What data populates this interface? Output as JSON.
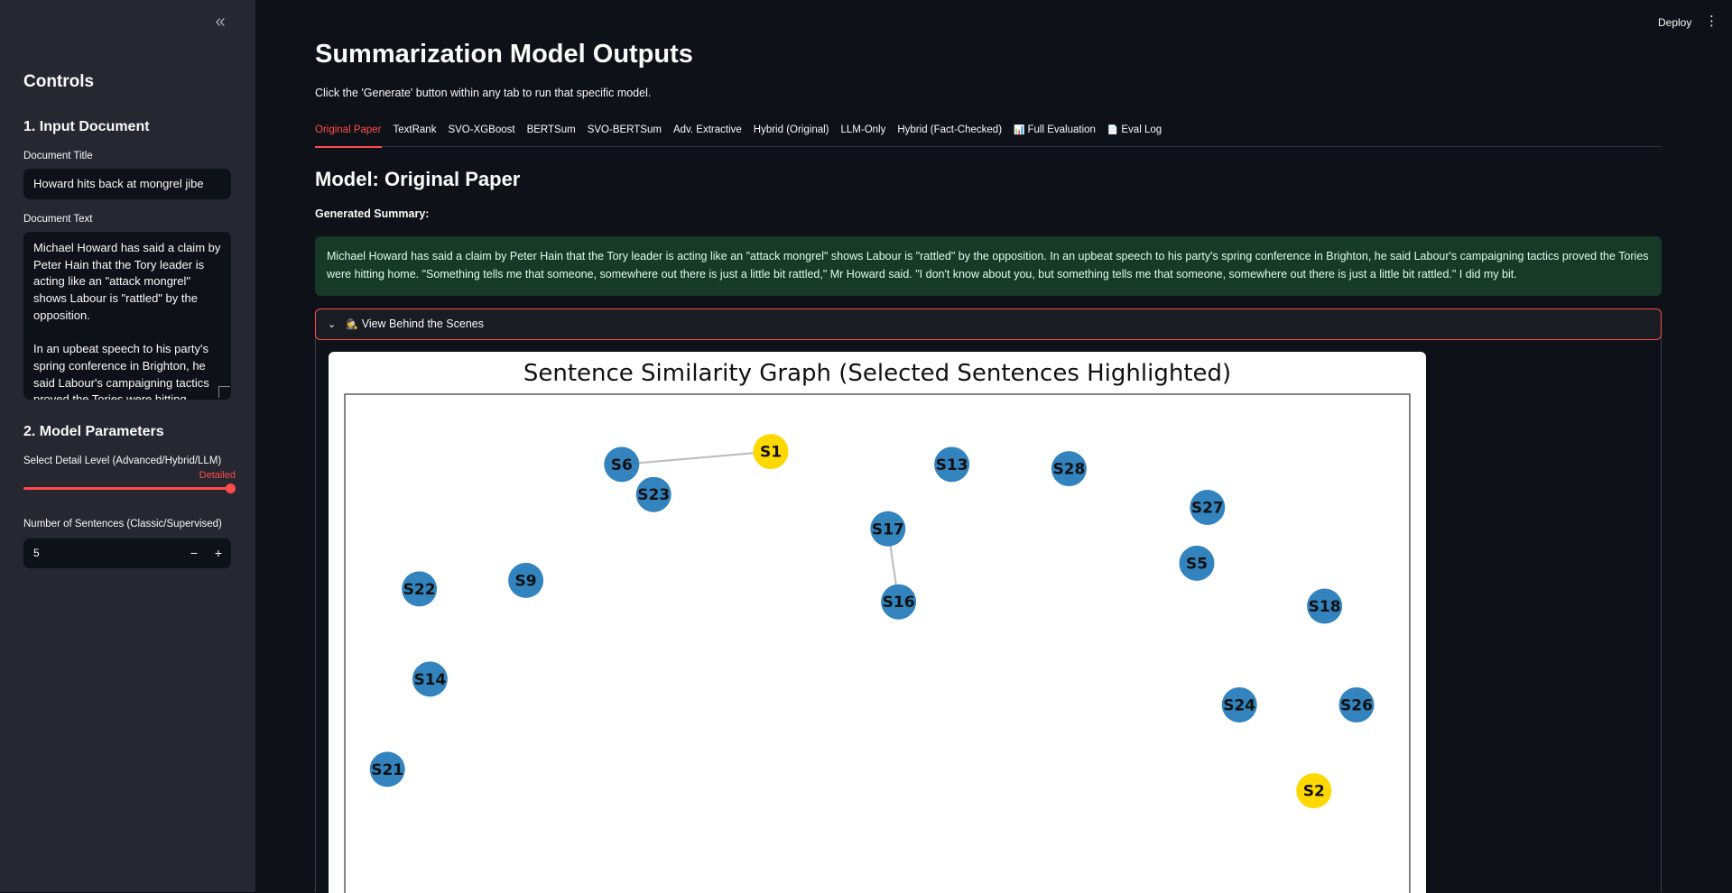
{
  "sidebar": {
    "collapse_icon": "chevrons-left-icon",
    "heading": "Controls",
    "section1_title": "1. Input Document",
    "doc_title_label": "Document Title",
    "doc_title_value": "Howard hits back at mongrel jibe",
    "doc_text_label": "Document Text",
    "doc_text_value": "Michael Howard has said a claim by Peter Hain that the Tory leader is acting like an \"attack mongrel\" shows Labour is \"rattled\" by the opposition.\n\nIn an upbeat speech to his party's spring conference in Brighton, he said Labour's campaigning tactics proved the Tories were hitting",
    "section2_title": "2. Model Parameters",
    "detail_label": "Select Detail Level (Advanced/Hybrid/LLM)",
    "detail_value": "Detailed",
    "detail_fraction": 1.0,
    "sentences_label": "Number of Sentences (Classic/Supervised)",
    "sentences_value": "5",
    "minus": "−",
    "plus": "+"
  },
  "header": {
    "deploy": "Deploy",
    "menu_icon": "more-vertical-icon"
  },
  "main": {
    "title": "Summarization Model Outputs",
    "caption": "Click the 'Generate' button within any tab to run that specific model.",
    "tabs": [
      {
        "label": "Original Paper",
        "icon": ""
      },
      {
        "label": "TextRank",
        "icon": ""
      },
      {
        "label": "SVO-XGBoost",
        "icon": ""
      },
      {
        "label": "BERTSum",
        "icon": ""
      },
      {
        "label": "SVO-BERTSum",
        "icon": ""
      },
      {
        "label": "Adv. Extractive",
        "icon": ""
      },
      {
        "label": "Hybrid (Original)",
        "icon": ""
      },
      {
        "label": "LLM-Only",
        "icon": ""
      },
      {
        "label": "Hybrid (Fact-Checked)",
        "icon": ""
      },
      {
        "label": "Full Evaluation",
        "icon": "📊"
      },
      {
        "label": "Eval Log",
        "icon": "📄"
      }
    ],
    "active_tab": 0,
    "model_heading": "Model: Original Paper",
    "generated_label": "Generated Summary:",
    "summary": "Michael Howard has said a claim by Peter Hain that the Tory leader is acting like an \"attack mongrel\" shows Labour is \"rattled\" by the opposition. In an upbeat speech to his party's spring conference in Brighton, he said Labour's campaigning tactics proved the Tories were hitting home. \"Something tells me that someone, somewhere out there is just a little bit rattled,\" Mr Howard said. \"I don't know about you, but something tells me that someone, somewhere out there is just a little bit rattled.\" I did my bit.",
    "expander_label": "View Behind the Scenes",
    "expander_emoji": "🕵️",
    "colors": {
      "accent": "#ff4b4b",
      "node": "#3283be",
      "selected": "#ffd800",
      "edge": "#bfbfbf"
    }
  },
  "chart_data": {
    "type": "network",
    "title": "Sentence Similarity Graph (Selected Sentences Highlighted)",
    "nodes": [
      {
        "id": "S1",
        "selected": true,
        "x": 0.4,
        "y": 0.9
      },
      {
        "id": "S6",
        "selected": false,
        "x": 0.26,
        "y": 0.87
      },
      {
        "id": "S23",
        "selected": false,
        "x": 0.29,
        "y": 0.8
      },
      {
        "id": "S13",
        "selected": false,
        "x": 0.57,
        "y": 0.87
      },
      {
        "id": "S28",
        "selected": false,
        "x": 0.68,
        "y": 0.86
      },
      {
        "id": "S27",
        "selected": false,
        "x": 0.81,
        "y": 0.77
      },
      {
        "id": "S17",
        "selected": false,
        "x": 0.51,
        "y": 0.72
      },
      {
        "id": "S9",
        "selected": false,
        "x": 0.17,
        "y": 0.6
      },
      {
        "id": "S22",
        "selected": false,
        "x": 0.07,
        "y": 0.58
      },
      {
        "id": "S5",
        "selected": false,
        "x": 0.8,
        "y": 0.64
      },
      {
        "id": "S16",
        "selected": false,
        "x": 0.52,
        "y": 0.55
      },
      {
        "id": "S18",
        "selected": false,
        "x": 0.92,
        "y": 0.54
      },
      {
        "id": "S14",
        "selected": false,
        "x": 0.08,
        "y": 0.37
      },
      {
        "id": "S24",
        "selected": false,
        "x": 0.84,
        "y": 0.31
      },
      {
        "id": "S26",
        "selected": false,
        "x": 0.95,
        "y": 0.31
      },
      {
        "id": "S21",
        "selected": false,
        "x": 0.04,
        "y": 0.16
      },
      {
        "id": "S2",
        "selected": true,
        "x": 0.91,
        "y": 0.11
      }
    ],
    "edges": [
      [
        "S6",
        "S1"
      ],
      [
        "S17",
        "S16"
      ]
    ]
  }
}
